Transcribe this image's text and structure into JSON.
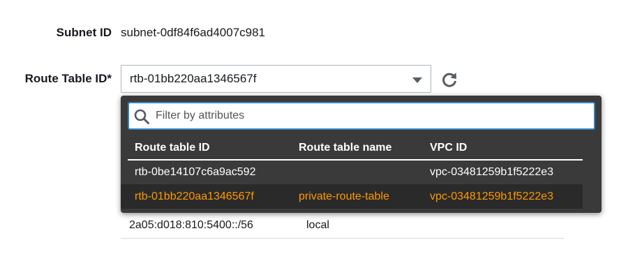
{
  "form": {
    "subnet_label": "Subnet ID",
    "subnet_value": "subnet-0df84f6ad4007c981",
    "route_table_label": "Route Table ID*",
    "route_table_selected": "rtb-01bb220aa1346567f"
  },
  "dropdown": {
    "filter_placeholder": "Filter by attributes",
    "columns": [
      "Route table ID",
      "Route table name",
      "VPC ID"
    ],
    "rows": [
      {
        "id": "rtb-0be14107c6a9ac592",
        "name": "",
        "vpc": "vpc-03481259b1f5222e3",
        "selected": false
      },
      {
        "id": "rtb-01bb220aa1346567f",
        "name": "private-route-table",
        "vpc": "vpc-03481259b1f5222e3",
        "selected": true
      }
    ]
  },
  "routes_table": {
    "rows": [
      {
        "destination": "2a05:d018:810:5400::/56",
        "target": "local"
      }
    ]
  },
  "colors": {
    "accent": "#ff9900",
    "focus_border": "#2e86c1",
    "dropdown_bg": "#3a3a3a"
  },
  "icons": {
    "refresh": "refresh-icon",
    "search": "search-icon",
    "caret": "caret-down-icon"
  }
}
